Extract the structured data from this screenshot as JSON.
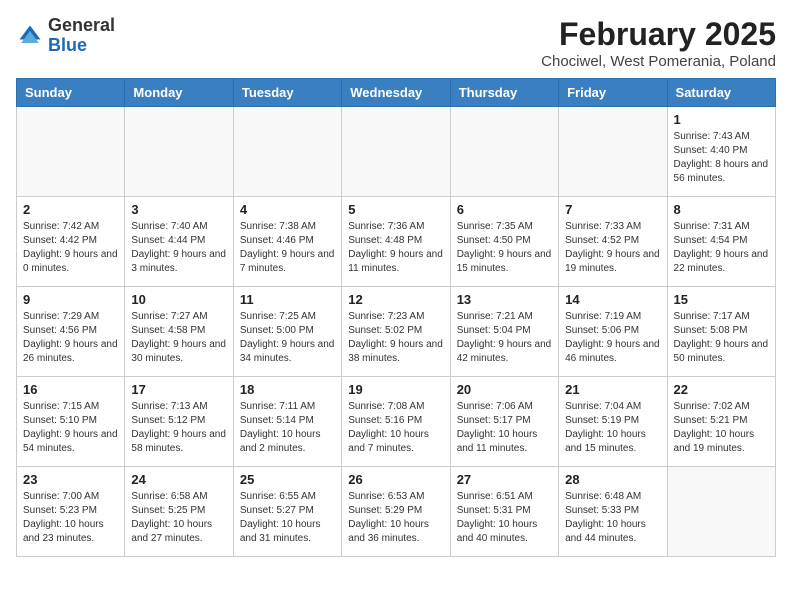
{
  "header": {
    "logo": {
      "general": "General",
      "blue": "Blue"
    },
    "title": "February 2025",
    "location": "Chociwel, West Pomerania, Poland"
  },
  "weekdays": [
    "Sunday",
    "Monday",
    "Tuesday",
    "Wednesday",
    "Thursday",
    "Friday",
    "Saturday"
  ],
  "weeks": [
    [
      {
        "day": "",
        "info": ""
      },
      {
        "day": "",
        "info": ""
      },
      {
        "day": "",
        "info": ""
      },
      {
        "day": "",
        "info": ""
      },
      {
        "day": "",
        "info": ""
      },
      {
        "day": "",
        "info": ""
      },
      {
        "day": "1",
        "info": "Sunrise: 7:43 AM\nSunset: 4:40 PM\nDaylight: 8 hours and 56 minutes."
      }
    ],
    [
      {
        "day": "2",
        "info": "Sunrise: 7:42 AM\nSunset: 4:42 PM\nDaylight: 9 hours and 0 minutes."
      },
      {
        "day": "3",
        "info": "Sunrise: 7:40 AM\nSunset: 4:44 PM\nDaylight: 9 hours and 3 minutes."
      },
      {
        "day": "4",
        "info": "Sunrise: 7:38 AM\nSunset: 4:46 PM\nDaylight: 9 hours and 7 minutes."
      },
      {
        "day": "5",
        "info": "Sunrise: 7:36 AM\nSunset: 4:48 PM\nDaylight: 9 hours and 11 minutes."
      },
      {
        "day": "6",
        "info": "Sunrise: 7:35 AM\nSunset: 4:50 PM\nDaylight: 9 hours and 15 minutes."
      },
      {
        "day": "7",
        "info": "Sunrise: 7:33 AM\nSunset: 4:52 PM\nDaylight: 9 hours and 19 minutes."
      },
      {
        "day": "8",
        "info": "Sunrise: 7:31 AM\nSunset: 4:54 PM\nDaylight: 9 hours and 22 minutes."
      }
    ],
    [
      {
        "day": "9",
        "info": "Sunrise: 7:29 AM\nSunset: 4:56 PM\nDaylight: 9 hours and 26 minutes."
      },
      {
        "day": "10",
        "info": "Sunrise: 7:27 AM\nSunset: 4:58 PM\nDaylight: 9 hours and 30 minutes."
      },
      {
        "day": "11",
        "info": "Sunrise: 7:25 AM\nSunset: 5:00 PM\nDaylight: 9 hours and 34 minutes."
      },
      {
        "day": "12",
        "info": "Sunrise: 7:23 AM\nSunset: 5:02 PM\nDaylight: 9 hours and 38 minutes."
      },
      {
        "day": "13",
        "info": "Sunrise: 7:21 AM\nSunset: 5:04 PM\nDaylight: 9 hours and 42 minutes."
      },
      {
        "day": "14",
        "info": "Sunrise: 7:19 AM\nSunset: 5:06 PM\nDaylight: 9 hours and 46 minutes."
      },
      {
        "day": "15",
        "info": "Sunrise: 7:17 AM\nSunset: 5:08 PM\nDaylight: 9 hours and 50 minutes."
      }
    ],
    [
      {
        "day": "16",
        "info": "Sunrise: 7:15 AM\nSunset: 5:10 PM\nDaylight: 9 hours and 54 minutes."
      },
      {
        "day": "17",
        "info": "Sunrise: 7:13 AM\nSunset: 5:12 PM\nDaylight: 9 hours and 58 minutes."
      },
      {
        "day": "18",
        "info": "Sunrise: 7:11 AM\nSunset: 5:14 PM\nDaylight: 10 hours and 2 minutes."
      },
      {
        "day": "19",
        "info": "Sunrise: 7:08 AM\nSunset: 5:16 PM\nDaylight: 10 hours and 7 minutes."
      },
      {
        "day": "20",
        "info": "Sunrise: 7:06 AM\nSunset: 5:17 PM\nDaylight: 10 hours and 11 minutes."
      },
      {
        "day": "21",
        "info": "Sunrise: 7:04 AM\nSunset: 5:19 PM\nDaylight: 10 hours and 15 minutes."
      },
      {
        "day": "22",
        "info": "Sunrise: 7:02 AM\nSunset: 5:21 PM\nDaylight: 10 hours and 19 minutes."
      }
    ],
    [
      {
        "day": "23",
        "info": "Sunrise: 7:00 AM\nSunset: 5:23 PM\nDaylight: 10 hours and 23 minutes."
      },
      {
        "day": "24",
        "info": "Sunrise: 6:58 AM\nSunset: 5:25 PM\nDaylight: 10 hours and 27 minutes."
      },
      {
        "day": "25",
        "info": "Sunrise: 6:55 AM\nSunset: 5:27 PM\nDaylight: 10 hours and 31 minutes."
      },
      {
        "day": "26",
        "info": "Sunrise: 6:53 AM\nSunset: 5:29 PM\nDaylight: 10 hours and 36 minutes."
      },
      {
        "day": "27",
        "info": "Sunrise: 6:51 AM\nSunset: 5:31 PM\nDaylight: 10 hours and 40 minutes."
      },
      {
        "day": "28",
        "info": "Sunrise: 6:48 AM\nSunset: 5:33 PM\nDaylight: 10 hours and 44 minutes."
      },
      {
        "day": "",
        "info": ""
      }
    ]
  ]
}
